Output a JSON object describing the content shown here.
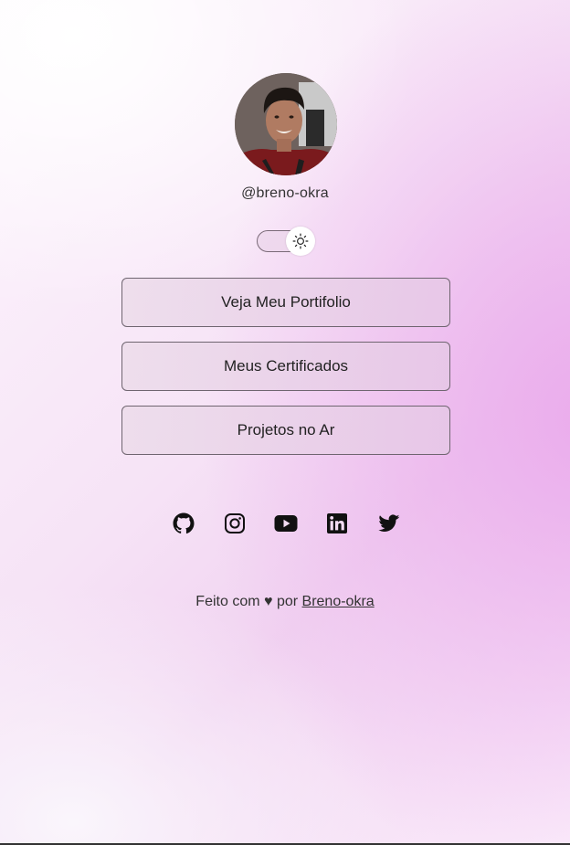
{
  "profile": {
    "username": "@breno-okra"
  },
  "theme_toggle": {
    "icon": "sun-icon",
    "state": "light"
  },
  "links": [
    {
      "label": "Veja Meu Portifolio"
    },
    {
      "label": "Meus Certificados"
    },
    {
      "label": "Projetos no Ar"
    }
  ],
  "socials": [
    {
      "icon": "github-icon"
    },
    {
      "icon": "instagram-icon"
    },
    {
      "icon": "youtube-icon"
    },
    {
      "icon": "linkedin-icon"
    },
    {
      "icon": "twitter-icon"
    }
  ],
  "footer": {
    "prefix": "Feito com",
    "heart": "♥",
    "by": "por",
    "author": "Breno-okra"
  },
  "colors": {
    "accent": "#efb9ee",
    "button_border": "#6f6570",
    "text": "#222222"
  }
}
